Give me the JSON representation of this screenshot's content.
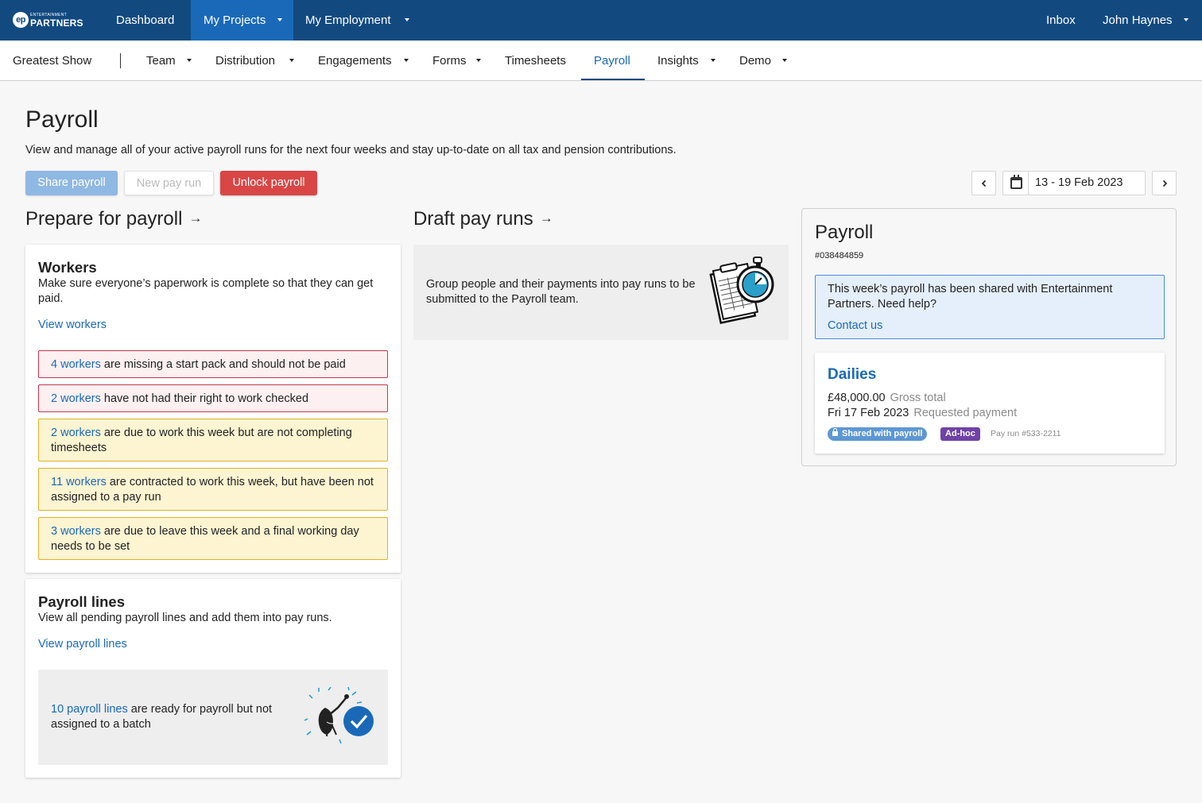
{
  "topnav": {
    "logo_small": "ENTERTAINMENT",
    "logo_big": "PARTNERS",
    "logo_mark": "ep",
    "dashboard": "Dashboard",
    "my_projects": "My Projects",
    "my_employment": "My Employment",
    "inbox": "Inbox",
    "user": "John Haynes"
  },
  "subnav": {
    "project": "Greatest Show",
    "team": "Team",
    "distribution": "Distribution",
    "engagements": "Engagements",
    "forms": "Forms",
    "timesheets": "Timesheets",
    "payroll": "Payroll",
    "insights": "Insights",
    "demo": "Demo"
  },
  "page": {
    "title": "Payroll",
    "description": "View and manage all of your active payroll runs for the next four weeks and stay up-to-date on all tax and pension contributions."
  },
  "actions": {
    "share": "Share payroll",
    "new_run": "New pay run",
    "unlock": "Unlock payroll"
  },
  "date_range": "13 - 19 Feb 2023",
  "prepare": {
    "heading": "Prepare for payroll",
    "workers": {
      "title": "Workers",
      "description": "Make sure everyone’s paperwork is complete so that they can get paid.",
      "link": "View workers",
      "alerts": [
        {
          "link": "4 workers",
          "text": " are missing a start pack and should not be paid"
        },
        {
          "link": "2 workers",
          "text": " have not had their right to work checked"
        },
        {
          "link": "2 workers",
          "text": " are due to work this week but are not completing timesheets"
        },
        {
          "link": "11 workers",
          "text": " are contracted to work this week, but have been not assigned to a pay run"
        },
        {
          "link": "3 workers",
          "text": " are due to leave this week and a final working day needs to be set"
        }
      ]
    },
    "payroll_lines": {
      "title": "Payroll lines",
      "description": "View all pending payroll lines and add them into pay runs.",
      "link": "View payroll lines",
      "notice_link": "10 payroll lines",
      "notice_text": " are ready for payroll but not assigned to a batch"
    }
  },
  "draft": {
    "heading": "Draft pay runs",
    "description": "Group people and their payments into pay runs to be submitted to the Payroll team."
  },
  "panel": {
    "title": "Payroll",
    "id": "#038484859",
    "info_text": "This week’s payroll has been shared with Entertainment Partners. Need help?",
    "contact": "Contact us",
    "run": {
      "name": "Dailies",
      "amount": "£48,000.00",
      "amount_label": "Gross total",
      "date": "Fri 17 Feb 2023",
      "date_label": "Requested payment",
      "badge_shared": "Shared with payroll",
      "badge_adhoc": "Ad-hoc",
      "pay_run": "Pay run #533-2211"
    }
  },
  "colors": {
    "topnav_bg": "#124a80",
    "active_tab": "#1a69b8",
    "danger": "#d94646",
    "link": "#1a69b8",
    "adhoc": "#7042a6"
  }
}
